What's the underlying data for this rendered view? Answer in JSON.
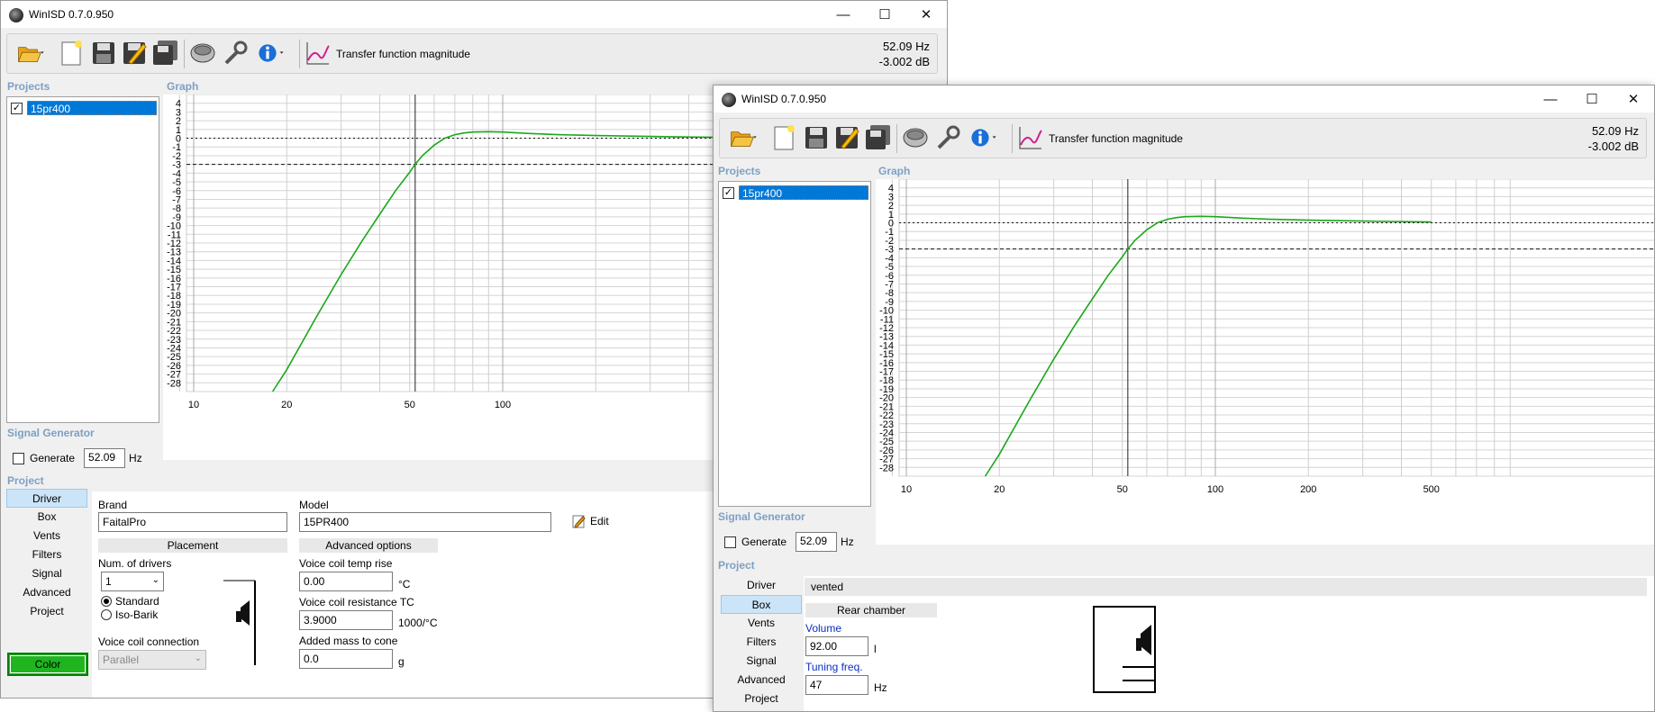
{
  "windows": [
    {
      "title": "WinISD 0.7.0.950",
      "toolbar": {
        "function_label": "Transfer function magnitude",
        "readout_freq": "52.09 Hz",
        "readout_db": "-3.002 dB"
      },
      "sections": {
        "projects": "Projects",
        "graph": "Graph",
        "signal_generator": "Signal Generator",
        "project": "Project"
      },
      "projects": [
        {
          "name": "15pr400",
          "checked": true
        }
      ],
      "signal_generator": {
        "generate_label": "Generate",
        "freq_value": "52.09",
        "unit": "Hz"
      },
      "tabs": [
        "Driver",
        "Box",
        "Vents",
        "Filters",
        "Signal",
        "Advanced",
        "Project"
      ],
      "active_tab": "Driver",
      "color_button": "Color",
      "driver_panel": {
        "brand_label": "Brand",
        "brand_value": "FaitalPro",
        "model_label": "Model",
        "model_value": "15PR400",
        "edit_label": "Edit",
        "placement_header": "Placement",
        "advanced_header": "Advanced options",
        "num_drivers_label": "Num. of drivers",
        "num_drivers_value": "1",
        "radio_standard": "Standard",
        "radio_isobarik": "Iso-Barik",
        "vc_connection_label": "Voice coil connection",
        "vc_connection_value": "Parallel",
        "vc_temp_label": "Voice coil temp rise",
        "vc_temp_value": "0.00",
        "vc_temp_unit": "°C",
        "vc_tc_label": "Voice coil resistance TC",
        "vc_tc_value": "3.9000",
        "vc_tc_unit": "1000/°C",
        "added_mass_label": "Added mass to cone",
        "added_mass_value": "0.0",
        "added_mass_unit": "g"
      },
      "graph": {
        "y_ticks": [
          "4",
          "3",
          "2",
          "1",
          "0",
          "-1",
          "-2",
          "-3",
          "-4",
          "-5",
          "-6",
          "-7",
          "-8",
          "-9",
          "-10",
          "-11",
          "-12",
          "-13",
          "-14",
          "-15",
          "-16",
          "-17",
          "-18",
          "-19",
          "-20",
          "-21",
          "-22",
          "-23",
          "-24",
          "-25",
          "-26",
          "-27",
          "-28"
        ],
        "x_ticks": [
          "10",
          "20",
          "50",
          "100"
        ]
      }
    },
    {
      "title": "WinISD 0.7.0.950",
      "toolbar": {
        "function_label": "Transfer function magnitude",
        "readout_freq": "52.09 Hz",
        "readout_db": "-3.002 dB"
      },
      "sections": {
        "projects": "Projects",
        "graph": "Graph",
        "signal_generator": "Signal Generator",
        "project": "Project"
      },
      "projects": [
        {
          "name": "15pr400",
          "checked": true
        }
      ],
      "signal_generator": {
        "generate_label": "Generate",
        "freq_value": "52.09",
        "unit": "Hz"
      },
      "tabs": [
        "Driver",
        "Box",
        "Vents",
        "Filters",
        "Signal",
        "Advanced",
        "Project"
      ],
      "active_tab": "Box",
      "box_panel": {
        "box_type": "vented",
        "rear_chamber_header": "Rear chamber",
        "volume_label": "Volume",
        "volume_value": "92.00",
        "volume_unit": "l",
        "tuning_label": "Tuning freq.",
        "tuning_value": "47",
        "tuning_unit": "Hz"
      },
      "graph": {
        "y_ticks": [
          "4",
          "3",
          "2",
          "1",
          "0",
          "-1",
          "-2",
          "-3",
          "-4",
          "-5",
          "-6",
          "-7",
          "-8",
          "-9",
          "-10",
          "-11",
          "-12",
          "-13",
          "-14",
          "-15",
          "-16",
          "-17",
          "-18",
          "-19",
          "-20",
          "-21",
          "-22",
          "-23",
          "-24",
          "-25",
          "-26",
          "-27",
          "-28"
        ],
        "x_ticks": [
          "10",
          "20",
          "50",
          "100",
          "200",
          "500"
        ]
      }
    }
  ],
  "chart_data": {
    "type": "line",
    "title": "Transfer function magnitude",
    "xlabel": "",
    "ylabel": "",
    "x_scale": "log",
    "xlim": [
      9,
      500
    ],
    "ylim": [
      -29,
      5
    ],
    "grid": true,
    "series": [
      {
        "color": "#1aa81a",
        "x": [
          18,
          20,
          25,
          30,
          35,
          40,
          45,
          50,
          52.09,
          55,
          60,
          65,
          70,
          75,
          80,
          90,
          100,
          120,
          150,
          200,
          300,
          500
        ],
        "y": [
          -29,
          -26.5,
          -20.4,
          -15.6,
          -11.8,
          -8.7,
          -6,
          -3.9,
          -3.0,
          -2.0,
          -0.8,
          0,
          0.4,
          0.6,
          0.7,
          0.75,
          0.7,
          0.55,
          0.4,
          0.3,
          0.2,
          0.1
        ]
      }
    ],
    "reference_lines": [
      {
        "axis": "y",
        "value": 0,
        "style": "dotted"
      },
      {
        "axis": "y",
        "value": -3,
        "style": "dashed"
      }
    ],
    "cursor": {
      "x": 52.09,
      "y": -3.002
    }
  }
}
